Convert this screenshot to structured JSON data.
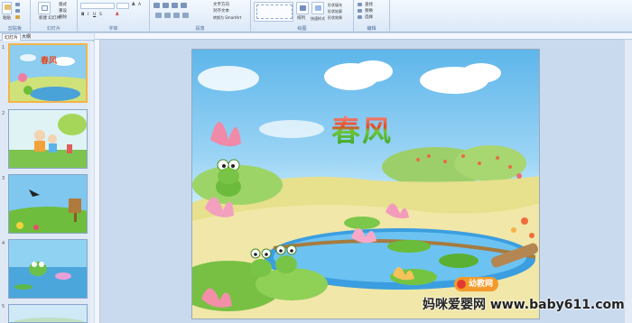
{
  "ribbon": {
    "groups": [
      {
        "label": "剪贴板"
      },
      {
        "label": "幻灯片"
      },
      {
        "label": "字体"
      },
      {
        "label": "段落"
      },
      {
        "label": "绘图"
      },
      {
        "label": "编辑"
      }
    ],
    "paste_label": "粘贴",
    "new_slide_label": "新建\n幻灯片",
    "delete_label": "删除",
    "layout_label": "版式",
    "reset_label": "重设",
    "text_direction_label": "文字方向",
    "align_text_label": "对齐文本",
    "smartart_label": "转换为 SmartArt",
    "arrange_label": "排列",
    "quick_styles_label": "快速样式",
    "shape_fill_label": "形状填充",
    "shape_outline_label": "形状轮廓",
    "shape_effects_label": "形状效果",
    "find_label": "查找",
    "replace_label": "替换",
    "select_label": "选择"
  },
  "panel": {
    "tabs": [
      "幻灯片",
      "大纲"
    ],
    "slides": [
      {
        "num": "1",
        "caption": "春风"
      },
      {
        "num": "2"
      },
      {
        "num": "3"
      },
      {
        "num": "4"
      },
      {
        "num": "5"
      }
    ]
  },
  "slide": {
    "title": "春风",
    "logo_text": "幼教网"
  },
  "watermark": "妈咪爱婴网 www.baby611.com",
  "colors": {
    "ribbon_bg": "#dbe8f7",
    "selected_thumb": "#f4b44a",
    "title_red": "#e6491f",
    "title_green": "#2e9b23"
  }
}
